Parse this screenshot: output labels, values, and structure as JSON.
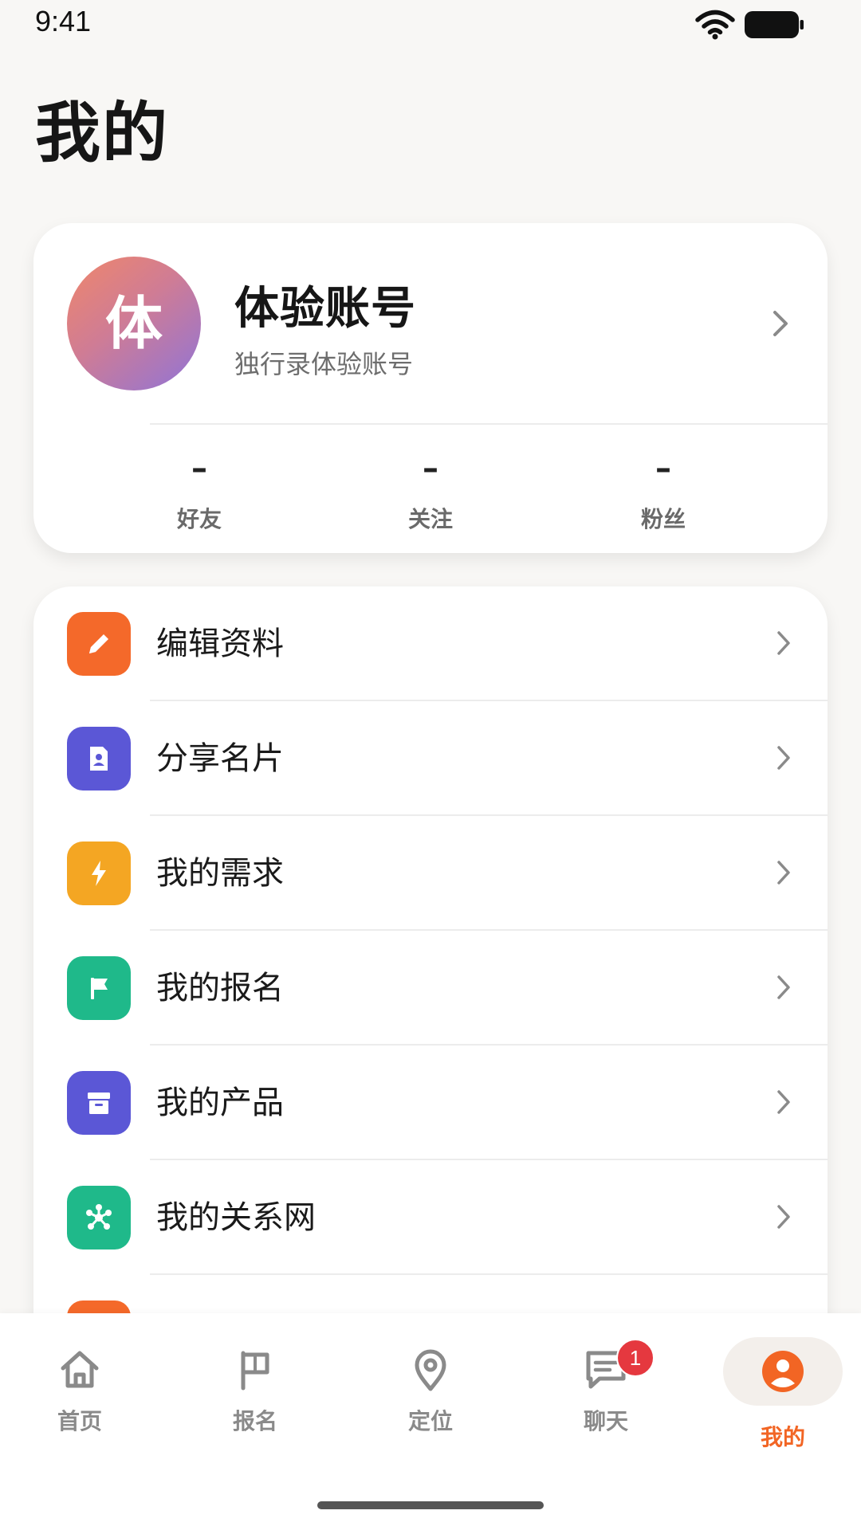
{
  "status_bar": {
    "time": "9:41",
    "icons": [
      "wifi-icon",
      "battery-icon"
    ]
  },
  "page": {
    "title": "我的"
  },
  "profile": {
    "avatar_text": "体",
    "name": "体验账号",
    "subtitle": "独行录体验账号",
    "stats": [
      {
        "value": "–",
        "label": "好友"
      },
      {
        "value": "–",
        "label": "关注"
      },
      {
        "value": "–",
        "label": "粉丝"
      }
    ]
  },
  "menu": {
    "items": [
      {
        "label": "编辑资料",
        "icon": "pencil-icon",
        "color": "#f4692a"
      },
      {
        "label": "分享名片",
        "icon": "contact-card-icon",
        "color": "#5b57d6"
      },
      {
        "label": "我的需求",
        "icon": "lightning-icon",
        "color": "#f4a623"
      },
      {
        "label": "我的报名",
        "icon": "flag-icon",
        "color": "#1fb98a"
      },
      {
        "label": "我的产品",
        "icon": "archive-box-icon",
        "color": "#5b57d6"
      },
      {
        "label": "我的关系网",
        "icon": "network-icon",
        "color": "#1fb98a"
      }
    ],
    "partial_item_color": "#f4692a"
  },
  "bottom_nav": {
    "items": [
      {
        "label": "首页",
        "icon": "home-icon"
      },
      {
        "label": "报名",
        "icon": "flag-icon"
      },
      {
        "label": "定位",
        "icon": "location-pin-icon"
      },
      {
        "label": "聊天",
        "icon": "chat-icon",
        "badge": "1"
      },
      {
        "label": "我的",
        "icon": "user-circle-icon",
        "active": true
      }
    ],
    "active_color": "#f26524",
    "inactive_color": "#8a8a8a",
    "badge_color": "#e5383f"
  }
}
